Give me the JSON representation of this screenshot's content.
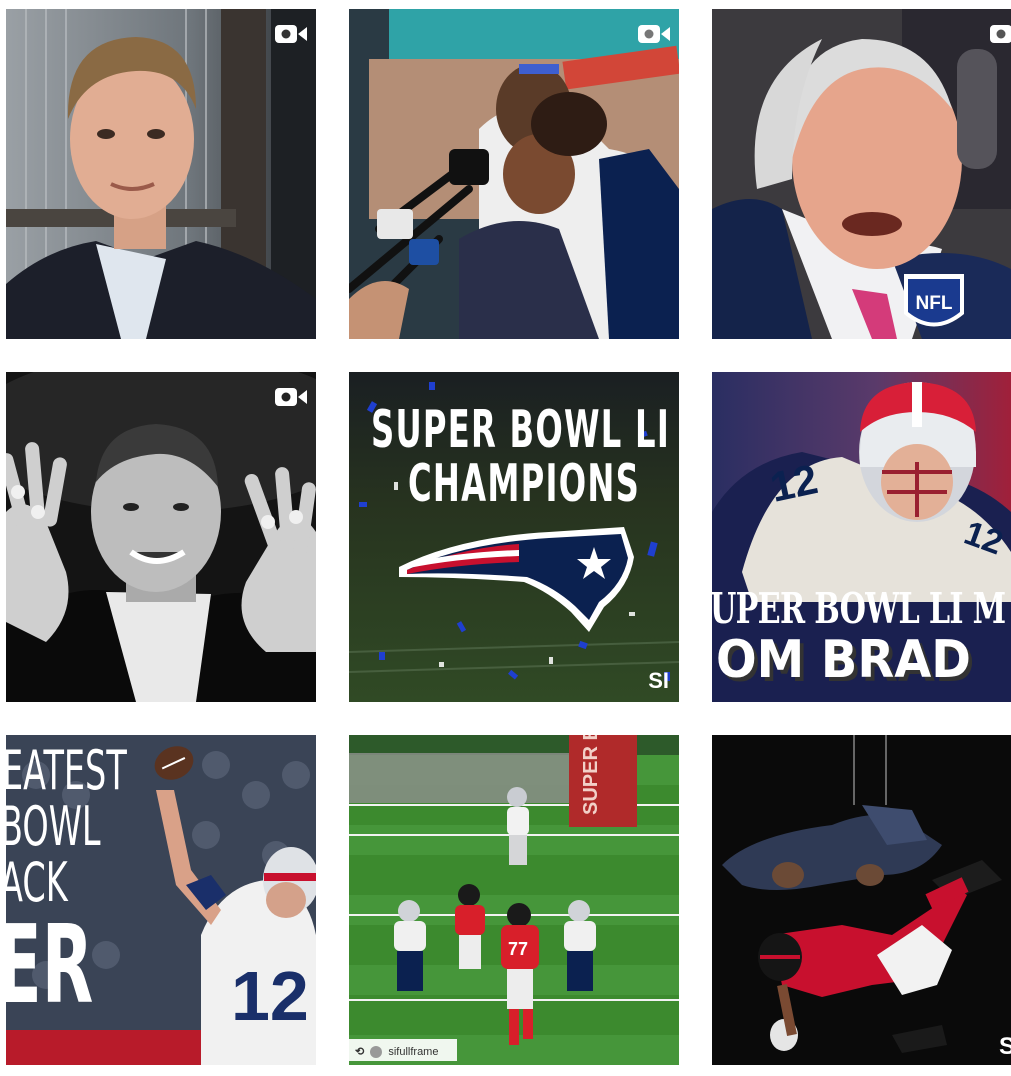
{
  "grid": {
    "tiles": [
      {
        "id": "t1",
        "name": "post-sportscaster-interview",
        "video": true
      },
      {
        "id": "t2",
        "name": "post-player-with-daughter-press",
        "video": true
      },
      {
        "id": "t3",
        "name": "post-team-owner-speaking",
        "video": true
      },
      {
        "id": "t4",
        "name": "post-quarterback-showing-rings",
        "video": true
      },
      {
        "id": "t5",
        "name": "post-champions-graphic",
        "video": false,
        "title_line1": "SUPER BOWL LI",
        "title_line2": "CHAMPIONS",
        "corner_logo": "SI"
      },
      {
        "id": "t6",
        "name": "post-mvp-graphic",
        "video": false,
        "line1": "UPER BOWL LI M",
        "line2": "OM BRAD"
      },
      {
        "id": "t7",
        "name": "post-greatest-comeback-graphic",
        "video": false,
        "lines": [
          "EATEST",
          "BOWL",
          "ACK",
          "ER"
        ]
      },
      {
        "id": "t8",
        "name": "post-field-play-overhead",
        "video": false,
        "endzone_text": "SUPER BO",
        "repost_user": "sifullframe",
        "repost_symbol": "⟲"
      },
      {
        "id": "t9",
        "name": "post-halftime-performers",
        "video": false,
        "corner_letter": "S"
      }
    ]
  },
  "colors": {
    "patriots_navy": "#0b2150",
    "patriots_red": "#c8102e",
    "falcons_red": "#c8102e",
    "field_green": "#3c8a2e",
    "white": "#ffffff"
  },
  "icons": {
    "video": "video-camera-icon",
    "repost": "repost-icon",
    "nfl": "nfl-shield-icon"
  }
}
